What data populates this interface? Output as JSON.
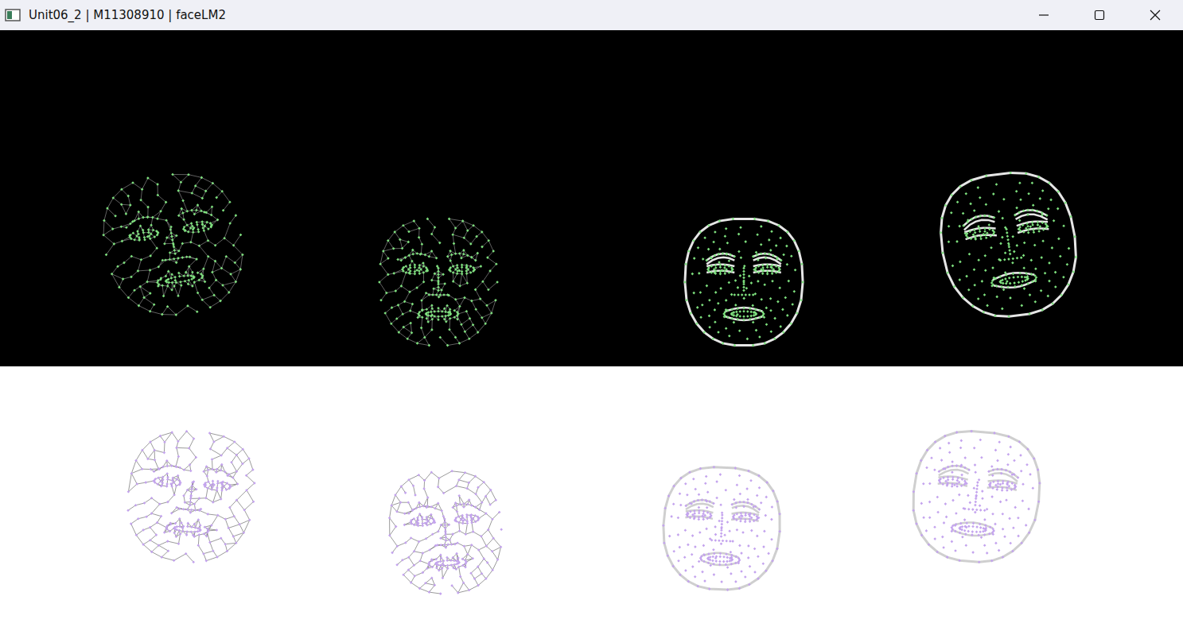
{
  "window": {
    "title": "Unit06_2 | M11308910 | faceLM2"
  },
  "panels": [
    {
      "kind": "dark",
      "color": "#7ee07e",
      "faces": [
        {
          "kind": "mesh"
        },
        {
          "kind": "mesh"
        },
        {
          "kind": "contour"
        },
        {
          "kind": "contour"
        }
      ]
    },
    {
      "kind": "light",
      "color": "#c4a4ee",
      "faces": [
        {
          "kind": "mesh"
        },
        {
          "kind": "mesh"
        },
        {
          "kind": "contour"
        },
        {
          "kind": "contour"
        }
      ]
    }
  ]
}
